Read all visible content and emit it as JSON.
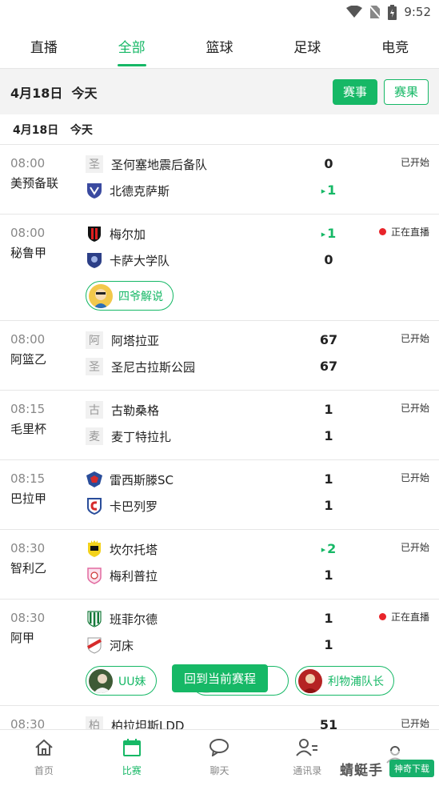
{
  "status_bar": {
    "time": "9:52"
  },
  "tabs": [
    {
      "label": "直播",
      "active": false
    },
    {
      "label": "全部",
      "active": true
    },
    {
      "label": "篮球",
      "active": false
    },
    {
      "label": "足球",
      "active": false
    },
    {
      "label": "电竞",
      "active": false
    }
  ],
  "date_header": {
    "title": "4月18日  今天",
    "events_button": "赛事",
    "results_button": "赛果"
  },
  "sub_date": "4月18日   今天",
  "matches": [
    {
      "time": "08:00",
      "league": "美预备联",
      "status": "已开始",
      "home": {
        "name": "圣何塞地震后备队",
        "logo_char": "圣",
        "score": "0"
      },
      "away": {
        "name": "北德克萨斯",
        "score": "1",
        "scored": true
      }
    },
    {
      "time": "08:00",
      "league": "秘鲁甲",
      "status": "正在直播",
      "live": true,
      "home": {
        "name": "梅尔加",
        "score": "1",
        "scored": true
      },
      "away": {
        "name": "卡萨大学队",
        "score": "0"
      },
      "commentators": [
        {
          "name": "四爷解说"
        }
      ]
    },
    {
      "time": "08:00",
      "league": "阿篮乙",
      "status": "已开始",
      "home": {
        "name": "阿塔拉亚",
        "logo_char": "阿",
        "score": "67"
      },
      "away": {
        "name": "圣尼古拉斯公园",
        "logo_char": "圣",
        "score": "67"
      }
    },
    {
      "time": "08:15",
      "league": "毛里杯",
      "status": "已开始",
      "home": {
        "name": "古勒桑格",
        "logo_char": "古",
        "score": "1"
      },
      "away": {
        "name": "麦丁特拉扎",
        "logo_char": "麦",
        "score": "1"
      }
    },
    {
      "time": "08:15",
      "league": "巴拉甲",
      "status": "已开始",
      "home": {
        "name": "雷西斯滕SC",
        "score": "1"
      },
      "away": {
        "name": "卡巴列罗",
        "score": "1"
      }
    },
    {
      "time": "08:30",
      "league": "智利乙",
      "status": "已开始",
      "home": {
        "name": "坎尔托塔",
        "score": "2",
        "scored": true
      },
      "away": {
        "name": "梅利普拉",
        "score": "1"
      }
    },
    {
      "time": "08:30",
      "league": "阿甲",
      "status": "正在直播",
      "live": true,
      "home": {
        "name": "班菲尔德",
        "score": "1"
      },
      "away": {
        "name": "河床",
        "score": "1"
      },
      "commentators": [
        {
          "name": "UU妹"
        },
        {
          "name": ""
        },
        {
          "name": "利物浦队长"
        }
      ]
    },
    {
      "time": "08:30",
      "league": "",
      "status": "已开始",
      "home": {
        "name": "柏拉坦斯LDD",
        "logo_char": "柏",
        "score": "51"
      }
    }
  ],
  "float_button": "回到当前赛程",
  "bottom_nav": [
    {
      "label": "首页",
      "icon": "home-icon",
      "active": false
    },
    {
      "label": "比赛",
      "icon": "calendar-icon",
      "active": true
    },
    {
      "label": "聊天",
      "icon": "chat-bubble-icon",
      "active": false
    },
    {
      "label": "通讯录",
      "icon": "contacts-icon",
      "active": false
    },
    {
      "label": "",
      "icon": "profile-icon",
      "active": false
    }
  ],
  "watermark": {
    "text": "蜻蜓手",
    "badge": "神奇下载"
  },
  "colors": {
    "accent": "#16b866",
    "live_dot": "#e8242a"
  }
}
